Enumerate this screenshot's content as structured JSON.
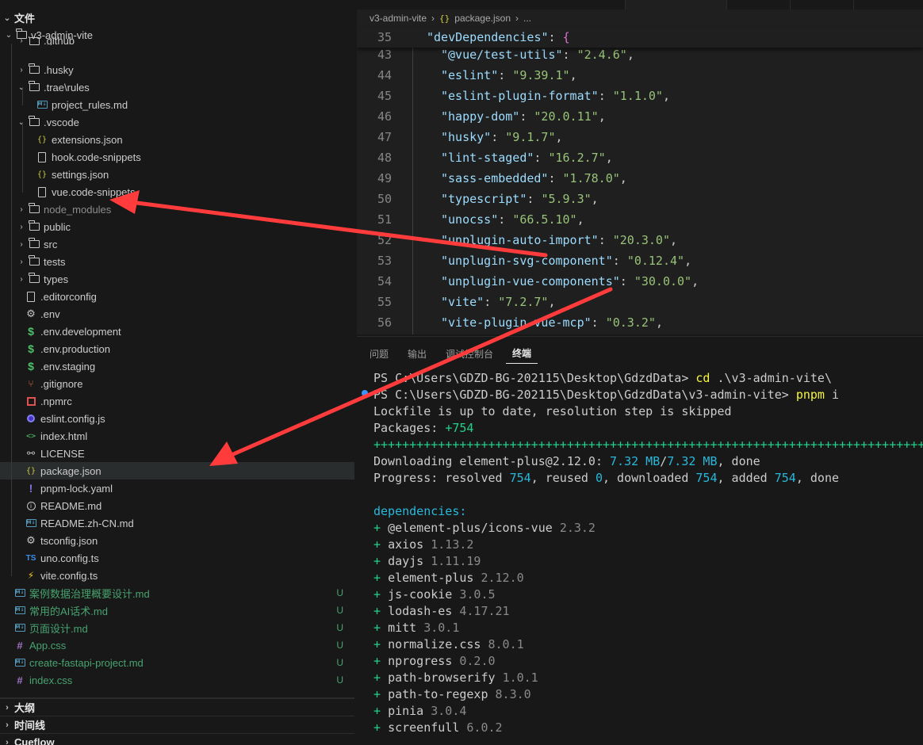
{
  "explorer": {
    "title": "文件",
    "root": "v3-admin-vite",
    "items": [
      {
        "label": ".github",
        "type": "folder",
        "collapsed": true,
        "depth": 1
      },
      {
        "label": ".husky",
        "type": "folder",
        "collapsed": true,
        "depth": 1
      },
      {
        "label": ".trae\\rules",
        "type": "folder",
        "collapsed": false,
        "depth": 1
      },
      {
        "label": "project_rules.md",
        "type": "md",
        "depth": 2
      },
      {
        "label": ".vscode",
        "type": "folder",
        "collapsed": false,
        "depth": 1
      },
      {
        "label": "extensions.json",
        "type": "json",
        "depth": 2
      },
      {
        "label": "hook.code-snippets",
        "type": "file",
        "depth": 2
      },
      {
        "label": "settings.json",
        "type": "json",
        "depth": 2
      },
      {
        "label": "vue.code-snippets",
        "type": "file",
        "depth": 2
      },
      {
        "label": "node_modules",
        "type": "folder",
        "collapsed": true,
        "depth": 1,
        "dim": true
      },
      {
        "label": "public",
        "type": "folder",
        "collapsed": true,
        "depth": 1
      },
      {
        "label": "src",
        "type": "folder",
        "collapsed": true,
        "depth": 1
      },
      {
        "label": "tests",
        "type": "folder",
        "collapsed": true,
        "depth": 1
      },
      {
        "label": "types",
        "type": "folder",
        "collapsed": true,
        "depth": 1
      },
      {
        "label": ".editorconfig",
        "type": "file",
        "depth": 1
      },
      {
        "label": ".env",
        "type": "gear",
        "depth": 1
      },
      {
        "label": ".env.development",
        "type": "dollar",
        "depth": 1
      },
      {
        "label": ".env.production",
        "type": "dollar",
        "depth": 1
      },
      {
        "label": ".env.staging",
        "type": "dollar",
        "depth": 1
      },
      {
        "label": ".gitignore",
        "type": "git",
        "depth": 1
      },
      {
        "label": ".npmrc",
        "type": "npm",
        "depth": 1
      },
      {
        "label": "eslint.config.js",
        "type": "eslint",
        "depth": 1
      },
      {
        "label": "index.html",
        "type": "html",
        "depth": 1
      },
      {
        "label": "LICENSE",
        "type": "license",
        "depth": 1
      },
      {
        "label": "package.json",
        "type": "json",
        "depth": 1,
        "selected": true
      },
      {
        "label": "pnpm-lock.yaml",
        "type": "yaml",
        "depth": 1
      },
      {
        "label": "README.md",
        "type": "info",
        "depth": 1
      },
      {
        "label": "README.zh-CN.md",
        "type": "md",
        "depth": 1
      },
      {
        "label": "tsconfig.json",
        "type": "gear",
        "depth": 1
      },
      {
        "label": "uno.config.ts",
        "type": "ts",
        "depth": 1
      },
      {
        "label": "vite.config.ts",
        "type": "vite",
        "depth": 1
      },
      {
        "label": "案例数据治理概要设计.md",
        "type": "md",
        "depth": 0,
        "git": "U"
      },
      {
        "label": "常用的AI话术.md",
        "type": "md",
        "depth": 0,
        "git": "U"
      },
      {
        "label": "页面设计.md",
        "type": "md",
        "depth": 0,
        "git": "U"
      },
      {
        "label": "App.css",
        "type": "css",
        "depth": 0,
        "git": "U"
      },
      {
        "label": "create-fastapi-project.md",
        "type": "md",
        "depth": 0,
        "git": "U"
      },
      {
        "label": "index.css",
        "type": "css",
        "depth": 0,
        "git": "U"
      }
    ],
    "sections": [
      "大纲",
      "时间线",
      "Cueflow"
    ]
  },
  "editor": {
    "breadcrumb": [
      "v3-admin-vite",
      "package.json",
      "..."
    ],
    "sticky_line": {
      "number": "35",
      "key": "\"devDependencies\"",
      "rest": ": {"
    },
    "lines": [
      {
        "number": "43",
        "key": "\"@vue/test-utils\"",
        "value": "\"2.4.6\""
      },
      {
        "number": "44",
        "key": "\"eslint\"",
        "value": "\"9.39.1\""
      },
      {
        "number": "45",
        "key": "\"eslint-plugin-format\"",
        "value": "\"1.1.0\""
      },
      {
        "number": "46",
        "key": "\"happy-dom\"",
        "value": "\"20.0.11\""
      },
      {
        "number": "47",
        "key": "\"husky\"",
        "value": "\"9.1.7\""
      },
      {
        "number": "48",
        "key": "\"lint-staged\"",
        "value": "\"16.2.7\""
      },
      {
        "number": "49",
        "key": "\"sass-embedded\"",
        "value": "\"1.78.0\""
      },
      {
        "number": "50",
        "key": "\"typescript\"",
        "value": "\"5.9.3\""
      },
      {
        "number": "51",
        "key": "\"unocss\"",
        "value": "\"66.5.10\""
      },
      {
        "number": "52",
        "key": "\"unplugin-auto-import\"",
        "value": "\"20.3.0\""
      },
      {
        "number": "53",
        "key": "\"unplugin-svg-component\"",
        "value": "\"0.12.4\""
      },
      {
        "number": "54",
        "key": "\"unplugin-vue-components\"",
        "value": "\"30.0.0\""
      },
      {
        "number": "55",
        "key": "\"vite\"",
        "value": "\"7.2.7\""
      },
      {
        "number": "56",
        "key": "\"vite-plugin-vue-mcp\"",
        "value": "\"0.3.2\""
      }
    ]
  },
  "panel": {
    "tabs": [
      "问题",
      "输出",
      "调试控制台",
      "终端"
    ],
    "active_tab": "终端",
    "terminal": {
      "prompt1": "PS C:\\Users\\GDZD-BG-202115\\Desktop\\GdzdData> ",
      "cmd1": "cd",
      "arg1": " .\\v3-admin-vite\\",
      "prompt2": "PS C:\\Users\\GDZD-BG-202115\\Desktop\\GdzdData\\v3-admin-vite> ",
      "cmd2": "pnpm",
      "arg2": " i",
      "lockfile": "Lockfile is up to date, resolution step is skipped",
      "packages_label": "Packages: ",
      "packages_value": "+754",
      "plus_bar": "++++++++++++++++++++++++++++++++++++++++++++++++++++++++++++++++++++++++++++++++",
      "download_label": "Downloading element-plus@2.12.0: ",
      "download_done": "7.32 MB",
      "download_sep": "/",
      "download_total": "7.32 MB",
      "download_tail": ", done",
      "progress_label": "Progress: resolved ",
      "resolved": "754",
      "reused_label": ", reused ",
      "reused": "0",
      "downloaded_label": ", downloaded ",
      "downloaded": "754",
      "added_label": ", added ",
      "added": "754",
      "progress_tail": ", done",
      "deps_header": "dependencies:",
      "deps": [
        {
          "name": "@element-plus/icons-vue",
          "version": "2.3.2"
        },
        {
          "name": "axios",
          "version": "1.13.2"
        },
        {
          "name": "dayjs",
          "version": "1.11.19"
        },
        {
          "name": "element-plus",
          "version": "2.12.0"
        },
        {
          "name": "js-cookie",
          "version": "3.0.5"
        },
        {
          "name": "lodash-es",
          "version": "4.17.21"
        },
        {
          "name": "mitt",
          "version": "3.0.1"
        },
        {
          "name": "normalize.css",
          "version": "8.0.1"
        },
        {
          "name": "nprogress",
          "version": "0.2.0"
        },
        {
          "name": "path-browserify",
          "version": "1.0.1"
        },
        {
          "name": "path-to-regexp",
          "version": "8.3.0"
        },
        {
          "name": "pinia",
          "version": "3.0.4"
        },
        {
          "name": "screenfull",
          "version": "6.0.2"
        }
      ]
    }
  },
  "colors": {
    "arrow": "#ff3b3b",
    "git_untracked": "#73c991",
    "json_key": "#9cdcfe",
    "json_string": "#98c379"
  }
}
